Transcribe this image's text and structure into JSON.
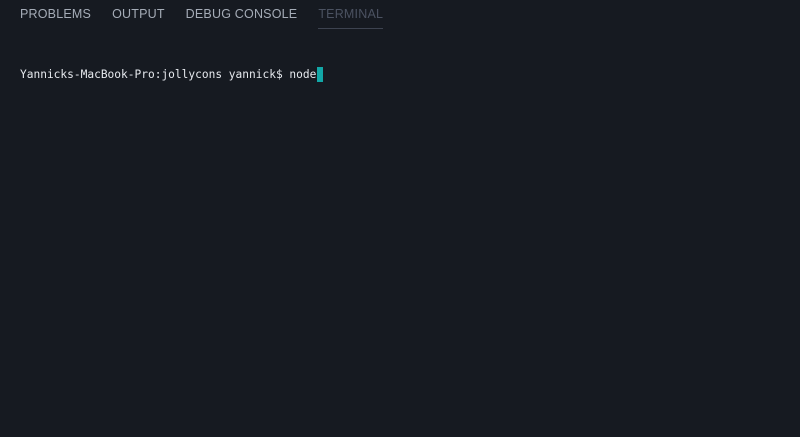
{
  "tabs": {
    "problems": "PROBLEMS",
    "output": "OUTPUT",
    "debug_console": "DEBUG CONSOLE",
    "terminal": "TERMINAL"
  },
  "active_tab": "terminal",
  "terminal": {
    "prompt": "Yannicks-MacBook-Pro:jollycons yannick$ ",
    "command": "node"
  },
  "colors": {
    "background": "#161a21",
    "cursor": "#12a7a7"
  }
}
